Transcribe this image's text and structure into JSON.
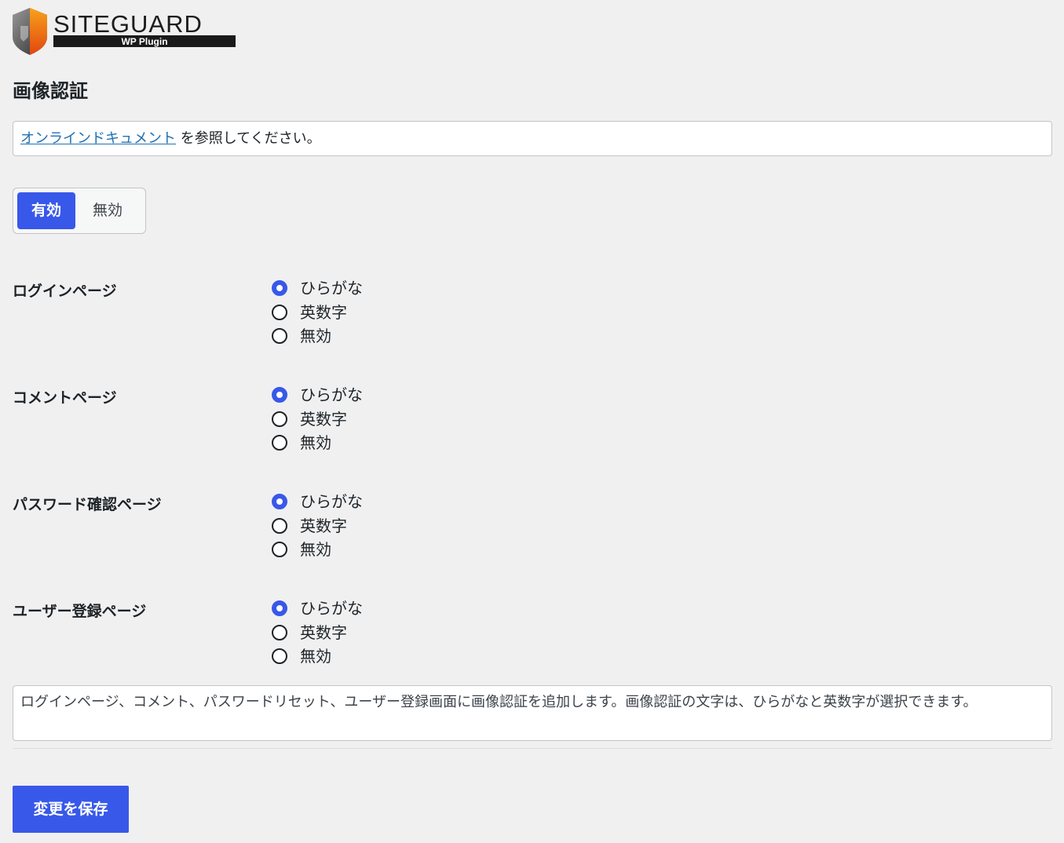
{
  "header": {
    "logo_text": "SITEGUARD",
    "logo_subtext": "WP Plugin",
    "page_title": "画像認証"
  },
  "doc_notice": {
    "link_text": "オンラインドキュメント",
    "suffix_text": " を参照してください。"
  },
  "toggle": {
    "on_label": "有効",
    "off_label": "無効",
    "selected": "on"
  },
  "settings": [
    {
      "label": "ログインページ",
      "options": [
        "ひらがな",
        "英数字",
        "無効"
      ],
      "selected_index": 0
    },
    {
      "label": "コメントページ",
      "options": [
        "ひらがな",
        "英数字",
        "無効"
      ],
      "selected_index": 0
    },
    {
      "label": "パスワード確認ページ",
      "options": [
        "ひらがな",
        "英数字",
        "無効"
      ],
      "selected_index": 0
    },
    {
      "label": "ユーザー登録ページ",
      "options": [
        "ひらがな",
        "英数字",
        "無効"
      ],
      "selected_index": 0
    }
  ],
  "description": "ログインページ、コメント、パスワードリセット、ユーザー登録画面に画像認証を追加します。画像認証の文字は、ひらがなと英数字が選択できます。",
  "save_button_label": "変更を保存",
  "colors": {
    "accent": "#3858e9",
    "link": "#2271b1",
    "background": "#f0f0f1"
  }
}
